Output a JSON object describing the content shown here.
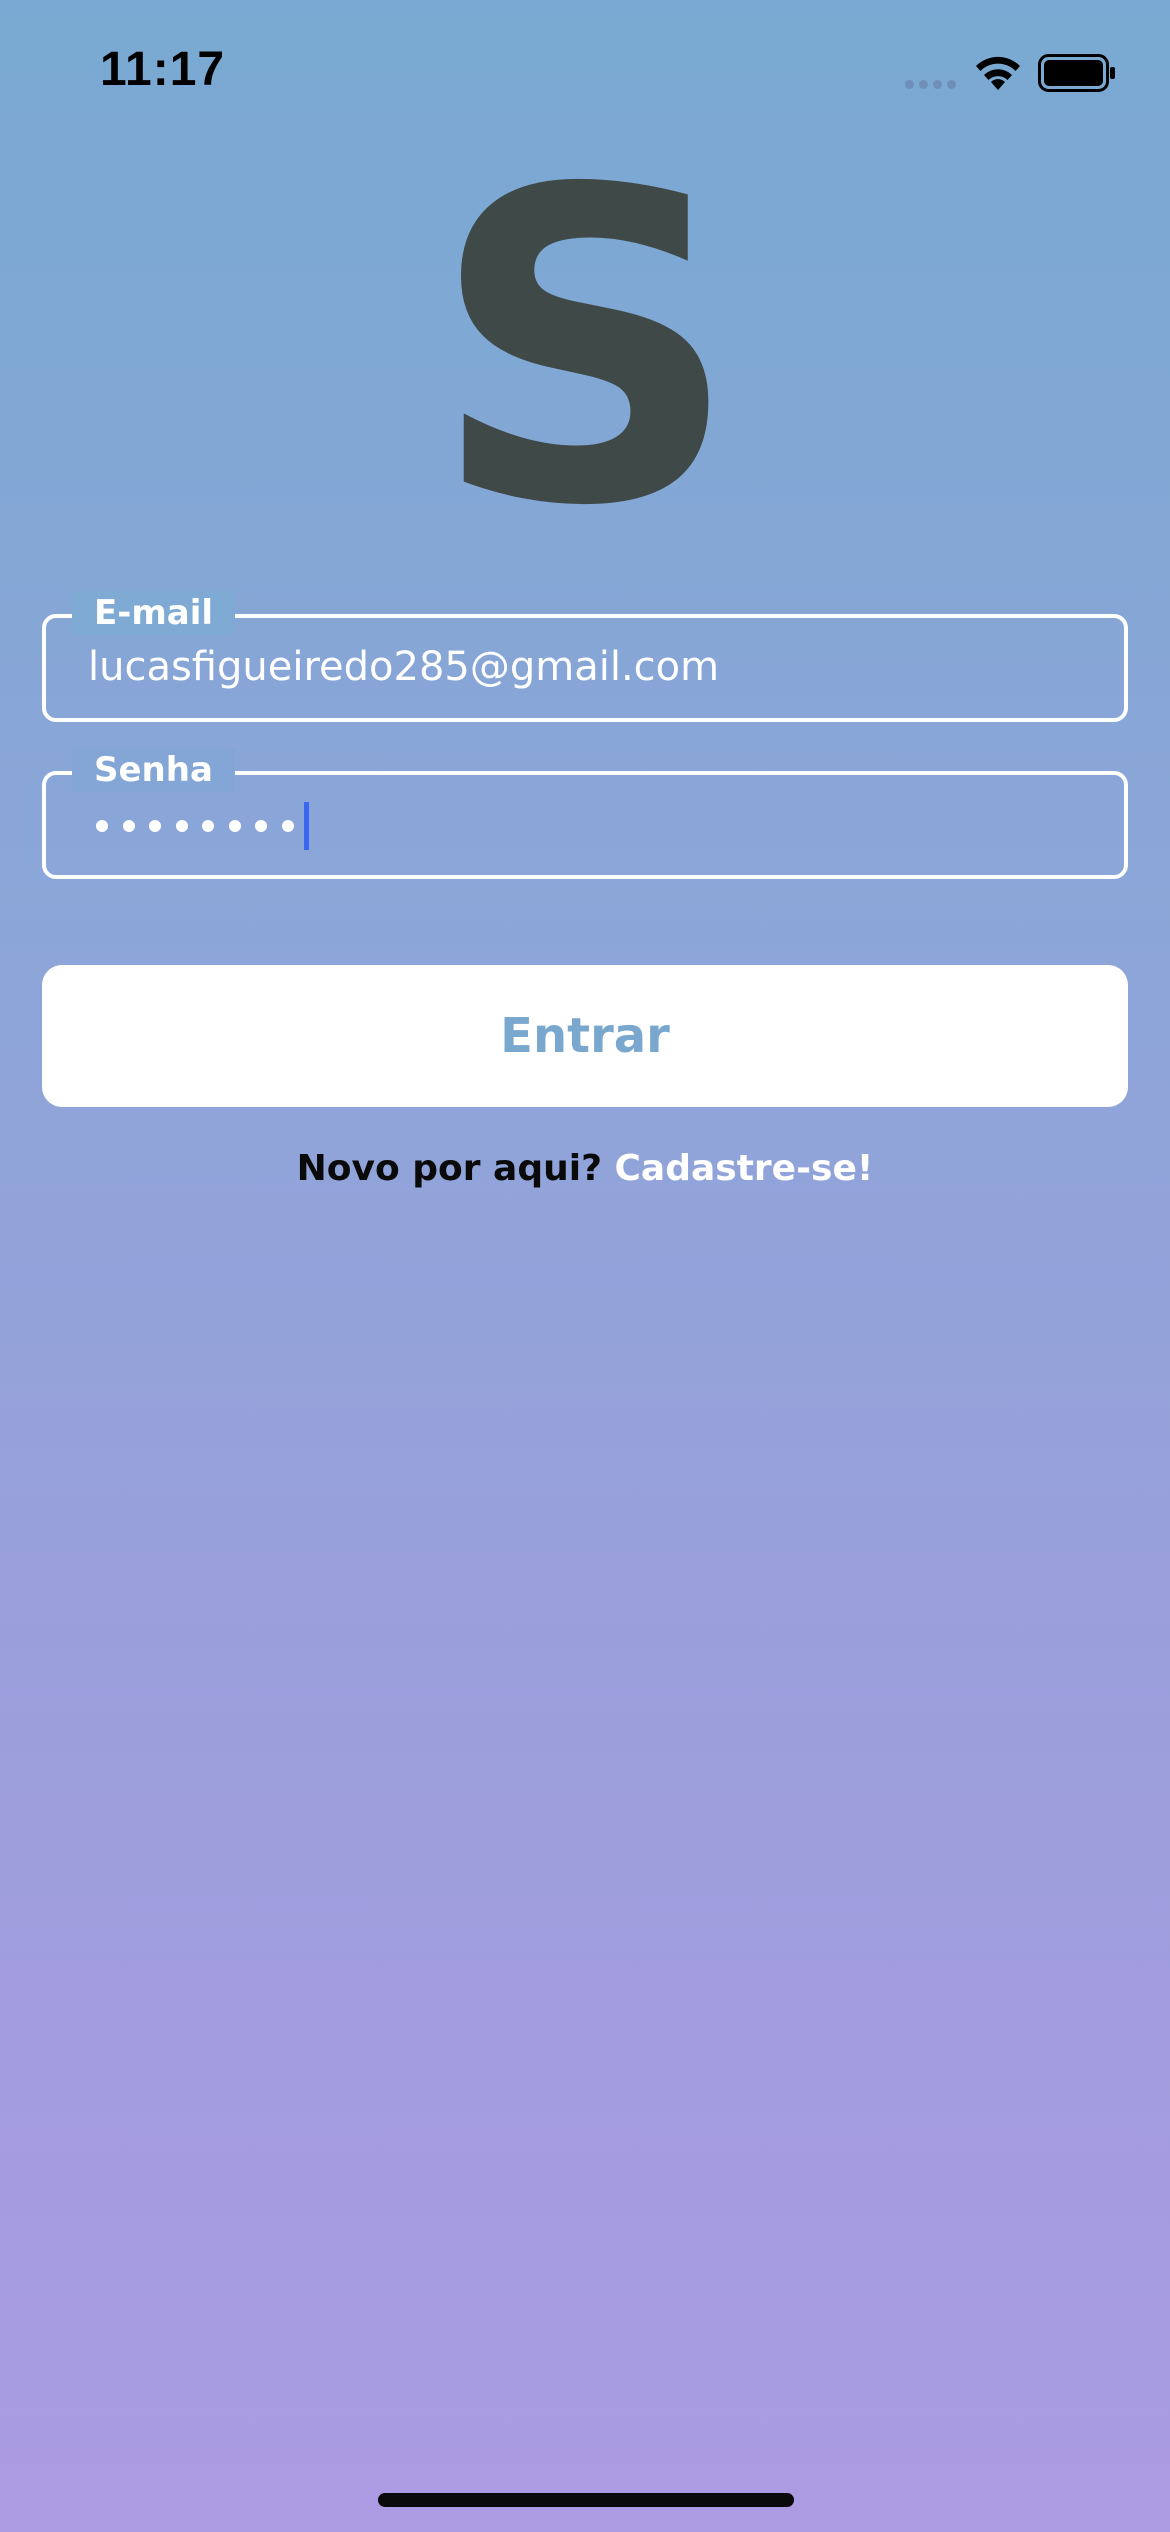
{
  "status_bar": {
    "time": "11:17",
    "icons": [
      "signal-icon",
      "wifi-icon",
      "battery-icon"
    ]
  },
  "logo": {
    "text": "S",
    "color": "#3f4a48"
  },
  "form": {
    "email": {
      "label": "E-mail",
      "value": "lucasfigueiredo285@gmail.com"
    },
    "password": {
      "label": "Senha",
      "masked_length": 8,
      "focused": true
    }
  },
  "login_button": {
    "label": "Entrar"
  },
  "signup": {
    "question": "Novo por aqui?",
    "link": "Cadastre-se!"
  },
  "colors": {
    "gradient_top": "#79a9d2",
    "gradient_bottom": "#ab9be2",
    "button_text": "#7aa7ce",
    "caret": "#3a66f0"
  }
}
